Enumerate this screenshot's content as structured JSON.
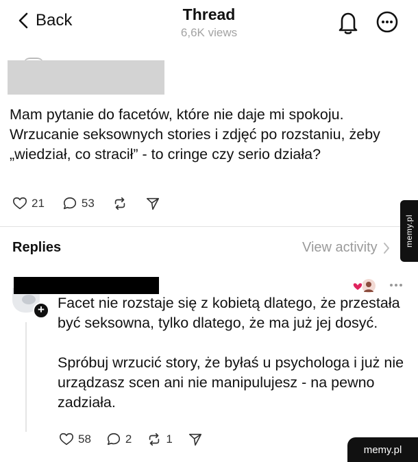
{
  "header": {
    "back_label": "Back",
    "title": "Thread",
    "views": "6,6K views",
    "icons": {
      "back": "chevron-left-icon",
      "notifications": "bell-icon",
      "more": "more-circle-icon"
    }
  },
  "post": {
    "text": "Mam pytanie do facetów, które nie daje mi spokoju. Wrzucanie seksownych stories i zdjęć po rozstaniu, żeby „wiedział, co stracił” - to cringe czy serio działa?",
    "likes": "21",
    "comments": "53"
  },
  "replies_section": {
    "label": "Replies",
    "view_activity": "View activity"
  },
  "reply": {
    "paragraph_1": "Facet nie rozstaje się z kobietą dlatego, że przestała być seksowna, tylko dlatego, że ma już jej dosyć.",
    "paragraph_2": "Spróbuj wrzucić story, że byłaś u psychologa i już nie urządzasz scen ani nie manipulujesz - na pewno zadziała.",
    "likes": "58",
    "comments": "2",
    "reposts": "1"
  },
  "watermarks": {
    "side": "memy.pl",
    "corner": "memy.pl"
  },
  "colors": {
    "text": "#111111",
    "muted": "#9a9a9a",
    "divider": "#e2e2e2",
    "watermark_bg": "#111111",
    "badge_heart": "#e0245e"
  }
}
